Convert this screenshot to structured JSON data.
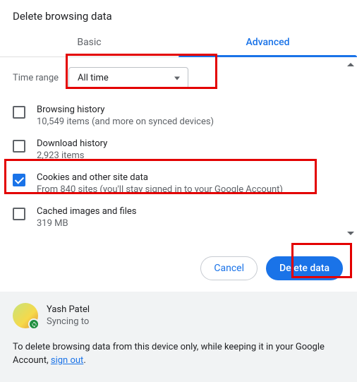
{
  "dialog": {
    "title": "Delete browsing data"
  },
  "tabs": {
    "basic": "Basic",
    "advanced": "Advanced"
  },
  "time_range": {
    "label": "Time range",
    "selected": "All time"
  },
  "options": {
    "browsing_history": {
      "title": "Browsing history",
      "sub": "10,549 items (and more on synced devices)"
    },
    "download_history": {
      "title": "Download history",
      "sub": "2,923 items"
    },
    "cookies": {
      "title": "Cookies and other site data",
      "sub": "From 840 sites (you'll stay signed in to your Google Account)"
    },
    "cached": {
      "title": "Cached images and files",
      "sub": "319 MB"
    }
  },
  "buttons": {
    "cancel": "Cancel",
    "delete": "Delete data"
  },
  "account": {
    "name": "Yash Patel",
    "sync_status": "Syncing to"
  },
  "info": {
    "prefix": "To delete browsing data from this device only, while keeping it in your Google Account, ",
    "link": "sign out",
    "suffix": "."
  }
}
